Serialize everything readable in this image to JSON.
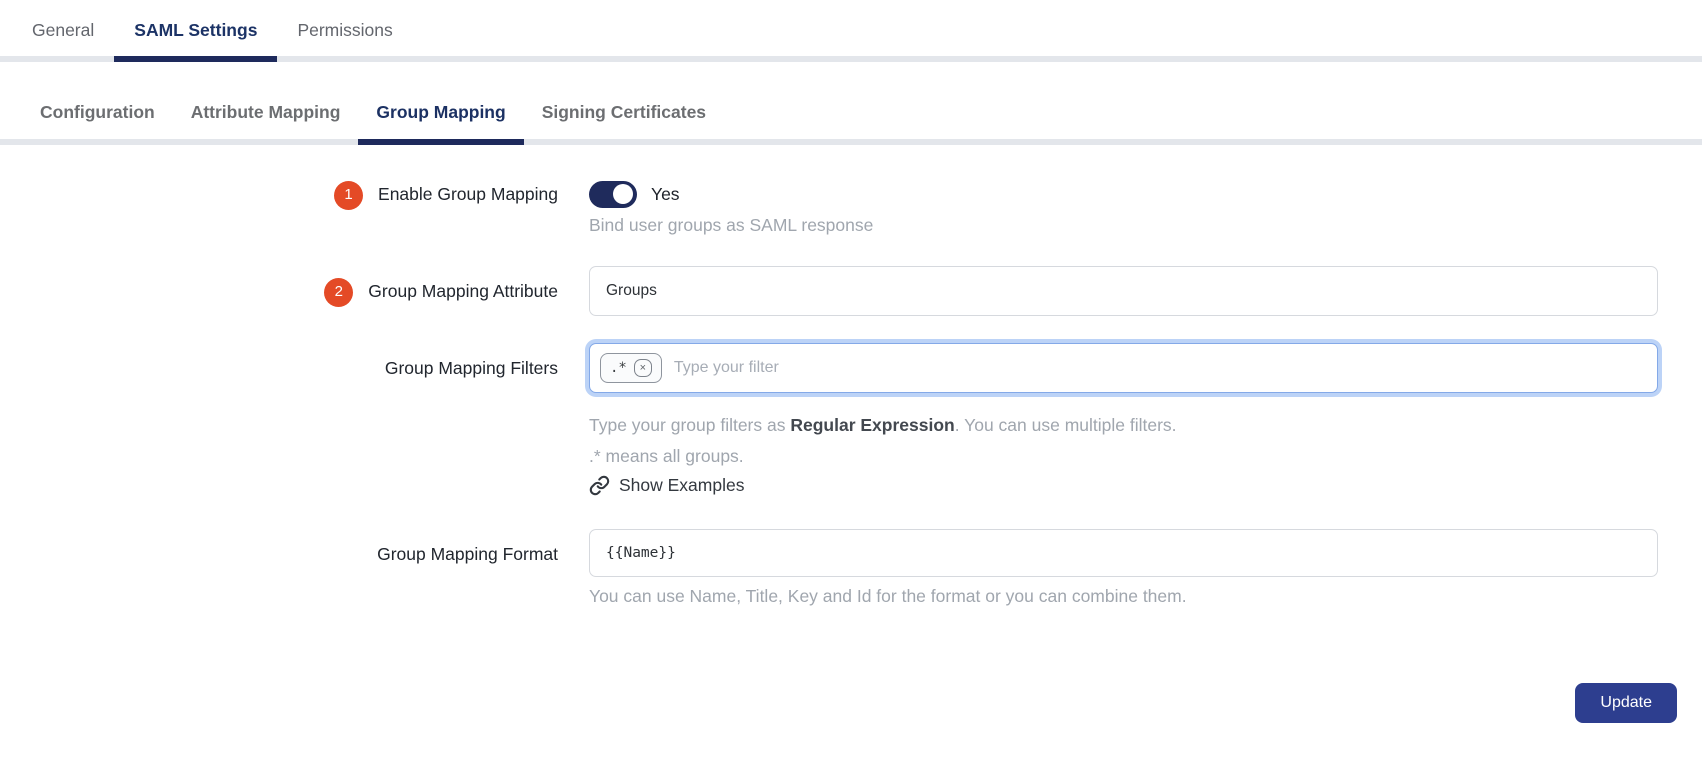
{
  "colors": {
    "accent_navy": "#1e2a5c",
    "active_tab_text": "#1c3366",
    "badge_red": "#e44a26",
    "button_navy": "#2d3e8f",
    "focus_ring_blue": "#bcd3f7",
    "helper_gray": "#a0a6ae"
  },
  "tabs": {
    "items": [
      {
        "label": "General",
        "active": false
      },
      {
        "label": "SAML Settings",
        "active": true
      },
      {
        "label": "Permissions",
        "active": false
      }
    ]
  },
  "subtabs": {
    "items": [
      {
        "label": "Configuration",
        "active": false
      },
      {
        "label": "Attribute Mapping",
        "active": false
      },
      {
        "label": "Group Mapping",
        "active": true
      },
      {
        "label": "Signing Certificates",
        "active": false
      }
    ]
  },
  "form": {
    "enable_group_mapping": {
      "step": "1",
      "label": "Enable Group Mapping",
      "value": "Yes",
      "help": "Bind user groups as SAML response"
    },
    "group_mapping_attribute": {
      "step": "2",
      "label": "Group Mapping Attribute",
      "value": "Groups"
    },
    "group_mapping_filters": {
      "label": "Group Mapping Filters",
      "chip": ".*",
      "chip_remove": "×",
      "placeholder": "Type your filter",
      "help_prefix": "Type your group filters as ",
      "help_strong": "Regular Expression",
      "help_suffix": ". You can use multiple filters.",
      "help_line2": ".* means all groups.",
      "link_label": "Show Examples"
    },
    "group_mapping_format": {
      "label": "Group Mapping Format",
      "value": "{{Name}}",
      "help": "You can use Name, Title, Key and Id for the format or you can combine them."
    },
    "update_label": "Update"
  }
}
